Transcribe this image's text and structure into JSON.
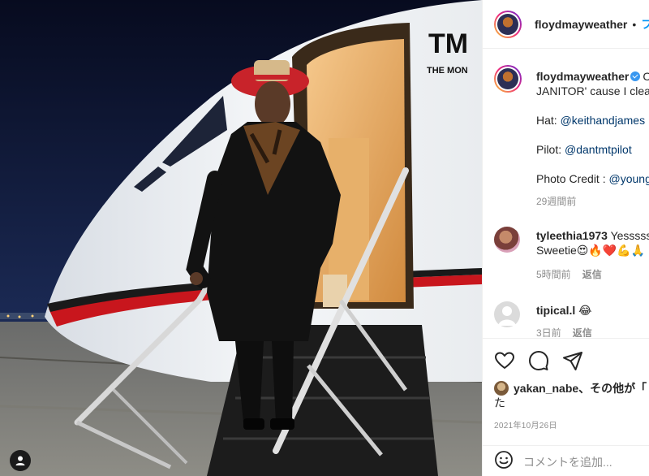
{
  "post": {
    "username": "floydmayweather",
    "separator": "•",
    "follow_label": "フ"
  },
  "caption": {
    "username": "floydmayweather",
    "line1_trail": "C",
    "line2": "JANITOR' cause I clea",
    "hat_prefix": "Hat: ",
    "hat_link": "@keithandjames",
    "pilot_prefix": "Pilot: ",
    "pilot_link": "@dantmtpilot",
    "photo_prefix": "Photo Credit : ",
    "photo_link": "@young",
    "time": "29週間前"
  },
  "comments": [
    {
      "username": "tyleethia1973",
      "text_line1": "Yesssss",
      "text_line2": "Sweetie😍🔥❤️💪🙏",
      "time": "5時間前",
      "reply_label": "返信"
    },
    {
      "username": "tipical.l",
      "text_line1": "😂",
      "time": "3日前",
      "reply_label": "返信"
    }
  ],
  "actions": {
    "likes_user": "yakan_nabe",
    "likes_rest": "、その他が「",
    "likes_line2": "た",
    "date": "2021年10月26日"
  },
  "comment_box": {
    "placeholder": "コメントを追加..."
  },
  "photo": {
    "jet_logo_line1": "TM",
    "jet_logo_line2": "THE MON"
  },
  "icons": [
    "user-icon",
    "heart-icon",
    "comment-icon",
    "share-icon",
    "emoji-icon",
    "verified-badge-icon"
  ],
  "colors": {
    "link": "#00376b",
    "follow": "#0095f6",
    "secondary_text": "#8e8e8e",
    "jet_stripe": "#c8161d",
    "hat": "#c8232a"
  }
}
